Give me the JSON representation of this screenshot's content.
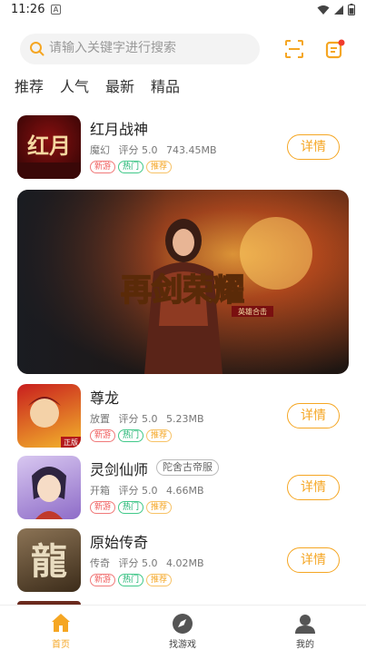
{
  "status": {
    "time": "11:26",
    "notif": "A"
  },
  "search": {
    "placeholder": "请输入关键字进行搜索"
  },
  "tabs": [
    "推荐",
    "人气",
    "最新",
    "精品"
  ],
  "tag_labels": {
    "new": "新游",
    "hot": "热门",
    "rec": "推荐"
  },
  "games": [
    {
      "name": "红月战神",
      "genre": "魔幻",
      "score": "评分 5.0",
      "size": "743.45MB",
      "action": "详情",
      "icon_text": "红月",
      "badge": ""
    },
    {
      "name": "尊龙",
      "genre": "放置",
      "score": "评分 5.0",
      "size": "5.23MB",
      "action": "详情",
      "icon_text": "正版",
      "badge": ""
    },
    {
      "name": "灵剑仙师",
      "genre": "开箱",
      "score": "评分 5.0",
      "size": "4.66MB",
      "action": "详情",
      "icon_text": "",
      "badge": "陀舍古帝服"
    },
    {
      "name": "原始传奇",
      "genre": "传奇",
      "score": "评分 5.0",
      "size": "4.02MB",
      "action": "详情",
      "icon_text": "龍",
      "badge": ""
    }
  ],
  "banner": {
    "title": "再剑荣耀",
    "subtitle": "英雄合击"
  },
  "nav": [
    {
      "label": "首页",
      "active": true
    },
    {
      "label": "找游戏",
      "active": false
    },
    {
      "label": "我的",
      "active": false
    }
  ],
  "colors": {
    "accent": "#f5a623",
    "tag_new": "#f05a5a",
    "tag_hot": "#16b06b"
  }
}
